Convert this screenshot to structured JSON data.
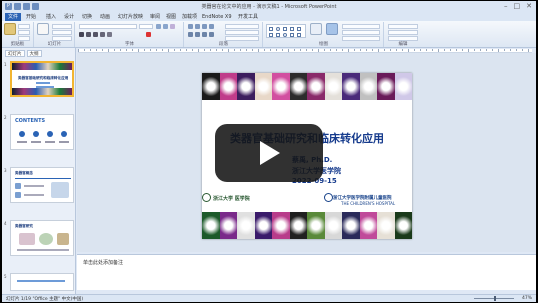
{
  "window": {
    "title": "类器官在论文中的应用 - 演示文稿1 - Microsoft PowerPoint"
  },
  "menu": {
    "file_label": "文件",
    "tabs": [
      "开始",
      "插入",
      "设计",
      "切换",
      "动画",
      "幻灯片放映",
      "审阅",
      "视图",
      "加载项",
      "EndNote X9",
      "开发工具"
    ]
  },
  "ribbon": {
    "groups": [
      "剪贴板",
      "幻灯片",
      "字体",
      "段落",
      "绘图",
      "编辑"
    ]
  },
  "panel": {
    "tabs": [
      "幻灯片",
      "大纲"
    ]
  },
  "thumbnails": [
    {
      "num": "1",
      "title": "类器官基础研究和临床转化应用"
    },
    {
      "num": "2",
      "title": "CONTENTS"
    },
    {
      "num": "3",
      "title": "类器官概念"
    },
    {
      "num": "4",
      "title": "类器官研究"
    },
    {
      "num": "5",
      "title": ""
    }
  ],
  "slide": {
    "title": "类器官基础研究和临床转化应用",
    "presenter": "蔡禹, Ph.D.",
    "affiliation": "浙江大学医学院",
    "date": "2022-09-15",
    "logo_left": "浙江大学 医学院",
    "logo_right": "浙江大学医学院附属儿童医院",
    "logo_right_en": "THE CHILDREN'S HOSPITAL"
  },
  "notes": {
    "placeholder": "单击此处添加备注"
  },
  "status": {
    "left": "幻灯片 1/19  \"Office 主题\"  中文(中国)",
    "zoom": "47%"
  },
  "colors": {
    "accent": "#153a8c",
    "selection": "#f2b531"
  }
}
